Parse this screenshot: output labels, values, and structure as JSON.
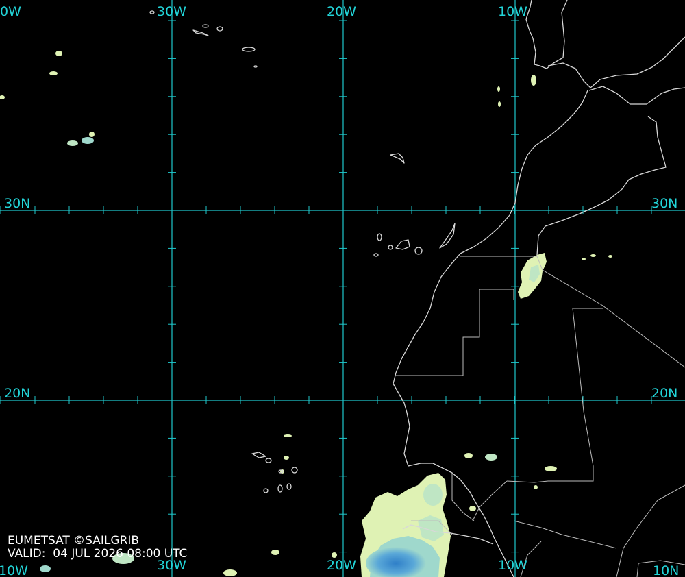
{
  "map": {
    "source": "EUMETSAT ©SAILGRIB",
    "valid_prefix": "VALID:",
    "valid_time": "04 JUL 2026 08:00 UTC",
    "colors": {
      "grid": "#1fc8cc",
      "coastline": "#d8d8d8",
      "cloud_light": "#dff2b4",
      "cloud_mid": "#9fd8cc",
      "cloud_deep": "#3a8fd0"
    },
    "labels": {
      "lon_top": [
        "0W",
        "30W",
        "20W",
        "10W"
      ],
      "lon_bottom": [
        "10W",
        "30W",
        "20W",
        "10W",
        "10N"
      ],
      "lat_left": [
        "30N",
        "20N"
      ],
      "lat_right": [
        "30N",
        "20N"
      ]
    }
  }
}
